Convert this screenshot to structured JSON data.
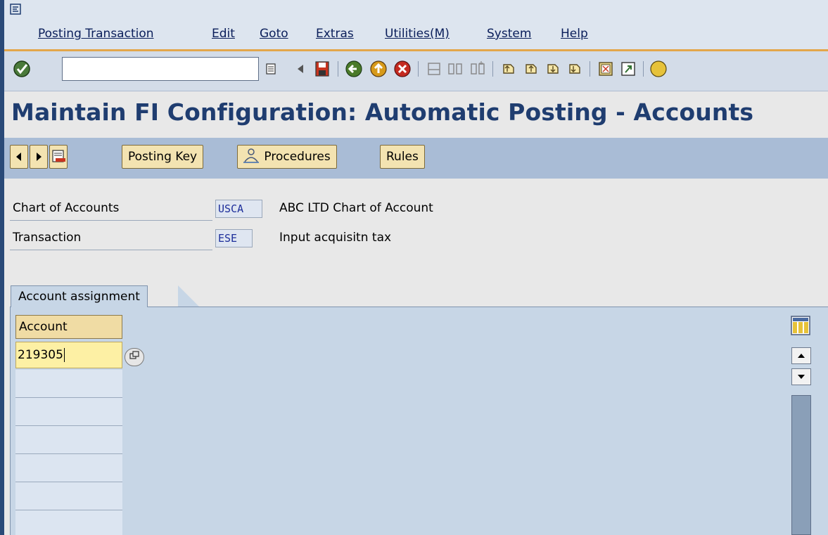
{
  "menu": {
    "items": [
      "Posting Transaction",
      "Edit",
      "Goto",
      "Extras",
      "Utilities(M)",
      "System",
      "Help"
    ]
  },
  "toolbar": {
    "command_value": "",
    "icons": [
      "enter-icon",
      "command-history-icon",
      "save-icon",
      "back-icon",
      "exit-icon",
      "cancel-icon",
      "print-icon",
      "find-icon",
      "find-next-icon",
      "first-page-icon",
      "previous-page-icon",
      "next-page-icon",
      "last-page-icon",
      "create-session-icon",
      "shortcut-icon",
      "help-icon"
    ]
  },
  "title": "Maintain FI Configuration: Automatic Posting - Accounts",
  "app_toolbar": {
    "posting_key": "Posting Key",
    "procedures": "Procedures",
    "rules": "Rules"
  },
  "header": {
    "chart_of_accounts_label": "Chart of Accounts",
    "chart_of_accounts_value": "USCA",
    "chart_of_accounts_desc": "ABC LTD Chart of Account",
    "transaction_label": "Transaction",
    "transaction_value": "ESE",
    "transaction_desc": "Input acquisitn tax"
  },
  "tab": {
    "label": "Account assignment"
  },
  "table": {
    "column_header": "Account",
    "rows": [
      "219305",
      "",
      "",
      "",
      "",
      "",
      ""
    ]
  },
  "colors": {
    "title": "#1f3d70",
    "accent_line": "#e3a64a",
    "button_fill": "#f3e3b1"
  }
}
